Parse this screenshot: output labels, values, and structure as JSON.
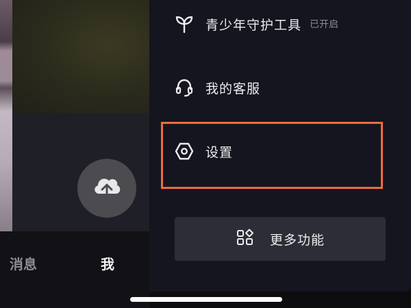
{
  "menu": {
    "youth_protection": {
      "label": "青少年守护工具",
      "badge": "已开启",
      "icon": "sprout-icon"
    },
    "customer_service": {
      "label": "我的客服",
      "icon": "headset-icon"
    },
    "settings": {
      "label": "设置",
      "icon": "hexagon-settings-icon"
    }
  },
  "more_functions": {
    "label": "更多功能",
    "icon": "grid-shapes-icon"
  },
  "bottom_nav": {
    "messages": "消息",
    "me": "我"
  },
  "upload": {
    "icon": "cloud-upload-icon"
  },
  "colors": {
    "highlight": "#f26b3d",
    "drawer_bg": "#15151f",
    "button_bg": "#2d2d37"
  }
}
